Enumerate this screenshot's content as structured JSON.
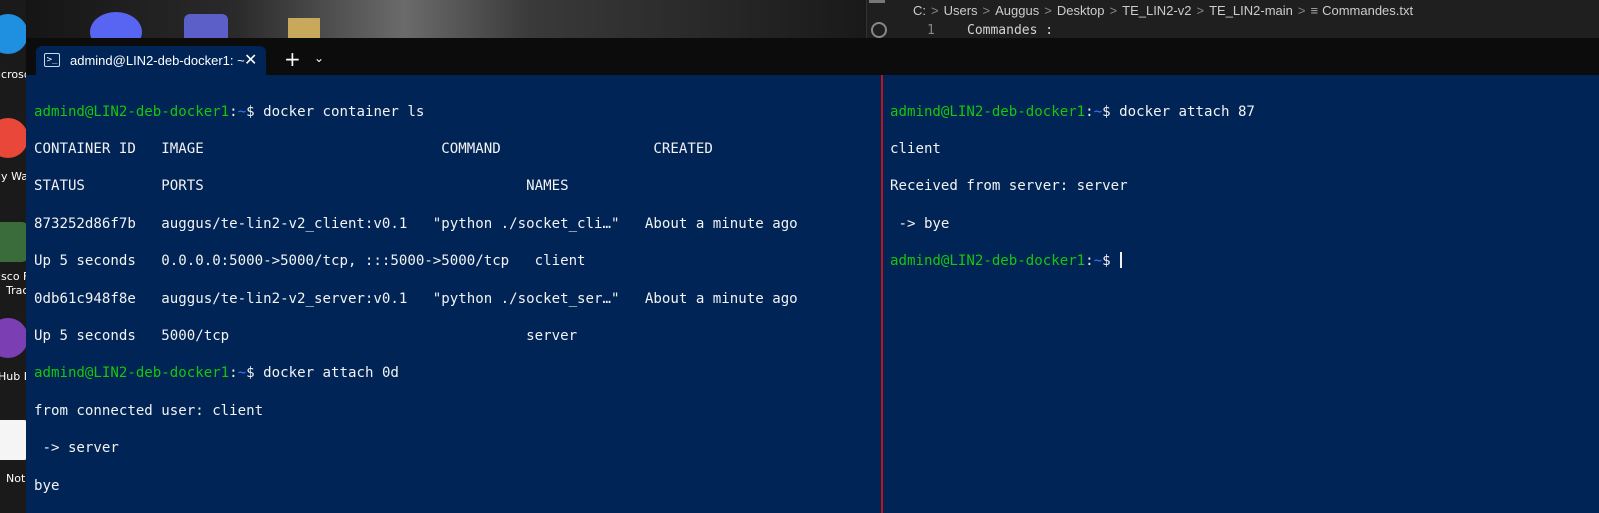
{
  "editor": {
    "breadcrumb": [
      "C:",
      "Users",
      "Auggus",
      "Desktop",
      "TE_LIN2-v2",
      "TE_LIN2-main",
      "Commandes.txt"
    ],
    "line_number": "1",
    "line_text": "Commandes :"
  },
  "desktop": {
    "labels": [
      "icroso",
      "ly Wa",
      "isco F",
      "Trac",
      "Hub D",
      "Noti"
    ]
  },
  "terminal": {
    "tab_title": "admind@LIN2-deb-docker1: ~",
    "tab_close": "✕",
    "new_tab": "+",
    "dropdown": "⌄",
    "left_pane": {
      "prompt_user": "admind@LIN2-deb-docker1",
      "prompt_path": "~",
      "cmd1": "docker container ls",
      "header1": "CONTAINER ID   IMAGE                            COMMAND                  CREATED",
      "header2": "STATUS         PORTS                                      NAMES",
      "row1a": "873252d86f7b   auggus/te-lin2-v2_client:v0.1   \"python ./socket_cli…\"   About a minute ago",
      "row1b": "Up 5 seconds   0.0.0.0:5000->5000/tcp, :::5000->5000/tcp   client",
      "row2a": "0db61c948f8e   auggus/te-lin2-v2_server:v0.1   \"python ./socket_ser…\"   About a minute ago",
      "row2b": "Up 5 seconds   5000/tcp                                   server",
      "cmd2": "docker attach 0d",
      "out1": "from connected user: client",
      "out2": " -> server",
      "out3": "bye"
    },
    "right_pane": {
      "prompt_user": "admind@LIN2-deb-docker1",
      "prompt_path": "~",
      "cmd1": "docker attach 87",
      "out1": "client",
      "out2": "Received from server: server",
      "out3": " -> bye"
    }
  }
}
